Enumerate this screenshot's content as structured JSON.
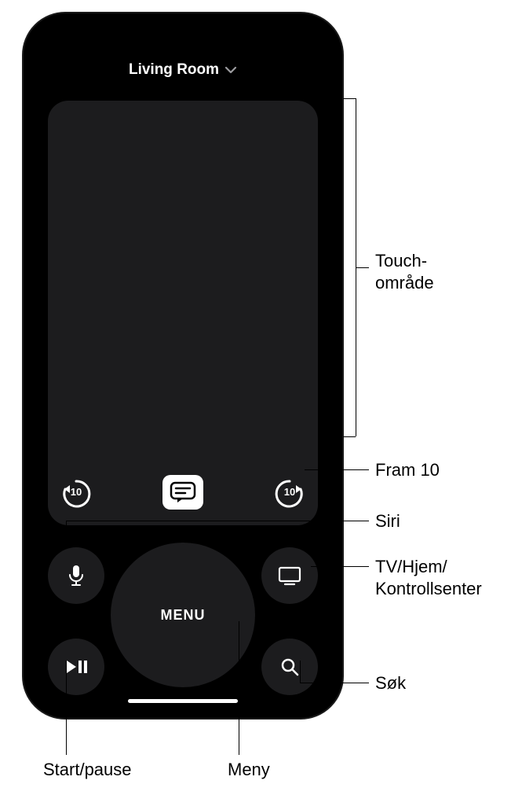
{
  "header": {
    "device_label": "Living Room"
  },
  "touch_row": {
    "back_seconds": "10",
    "forward_seconds": "10"
  },
  "buttons": {
    "menu_label": "MENU"
  },
  "callouts": {
    "touch_area": "Touch-\nområde",
    "forward_10": "Fram 10",
    "siri": "Siri",
    "tv_home": "TV/Hjem/\nKontrollsenter",
    "search": "Søk",
    "play_pause": "Start/pause",
    "menu": "Meny"
  }
}
